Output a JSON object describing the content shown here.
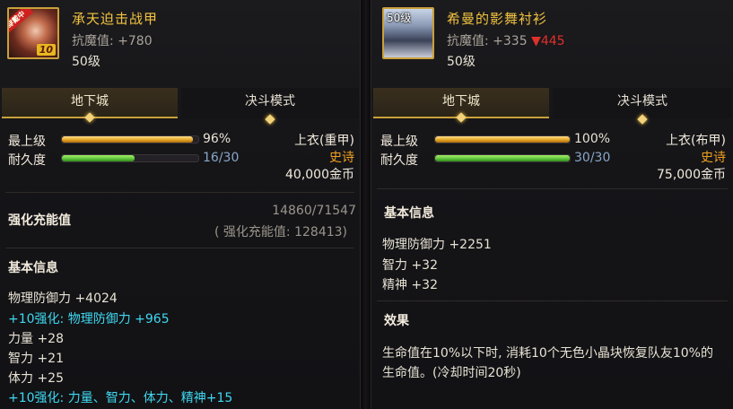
{
  "left": {
    "icon_badge": "穿戴中",
    "icon_plus": "10",
    "item_name": "承天迫击战甲",
    "magic_def_label": "抗魔值: +780",
    "level": "50级",
    "tabs": [
      "地下城",
      "决斗模式"
    ],
    "active_tab": 0,
    "top_grade_label": "最上级",
    "top_grade_value": "96%",
    "top_grade_percent": 96,
    "durability_label": "耐久度",
    "durability_value": "16/30",
    "durability_current": 16,
    "durability_max": 30,
    "slot_type": "上衣(重甲)",
    "rarity": "史诗",
    "price": "40,000金币",
    "charge_title": "强化充能值",
    "charge_value": "14860/71547",
    "charge_sub": "( 强化充能值: 128413)",
    "basic_title": "基本信息",
    "basic_lines": [
      {
        "text": "物理防御力 +4024",
        "color": "white"
      },
      {
        "text": "+10强化: 物理防御力 +965",
        "color": "cyan"
      },
      {
        "text": "力量 +28",
        "color": "white"
      },
      {
        "text": "智力 +21",
        "color": "white"
      },
      {
        "text": "体力 +25",
        "color": "white"
      },
      {
        "text": "+10强化: 力量、智力、体力、精神+15",
        "color": "cyan"
      }
    ]
  },
  "right": {
    "icon_level": "50级",
    "item_name": "希曼的影舞衬衫",
    "magic_def_label": "抗魔值: +335",
    "magic_def_diff": "▼445",
    "level": "50级",
    "tabs": [
      "地下城",
      "决斗模式"
    ],
    "active_tab": 0,
    "top_grade_label": "最上级",
    "top_grade_value": "100%",
    "top_grade_percent": 100,
    "durability_label": "耐久度",
    "durability_value": "30/30",
    "durability_current": 30,
    "durability_max": 30,
    "slot_type": "上衣(布甲)",
    "rarity": "史诗",
    "price": "75,000金币",
    "basic_title": "基本信息",
    "basic_lines": [
      {
        "text": "物理防御力 +2251",
        "color": "white"
      },
      {
        "text": "智力 +32",
        "color": "white"
      },
      {
        "text": "精神 +32",
        "color": "white"
      }
    ],
    "effect_title": "效果",
    "effect_lines": [
      "生命值在10%以下时, 消耗10个无色小晶块恢复队友10%的",
      "生命值。(冷却时间20秒)"
    ]
  },
  "colors": {
    "item_name": "#f2c341",
    "rarity": "#f0a020",
    "enhance_text": "#3fd8f0",
    "diff_down": "#e0302a",
    "bar_gold": "#e0a020",
    "bar_green": "#5cc03a"
  }
}
